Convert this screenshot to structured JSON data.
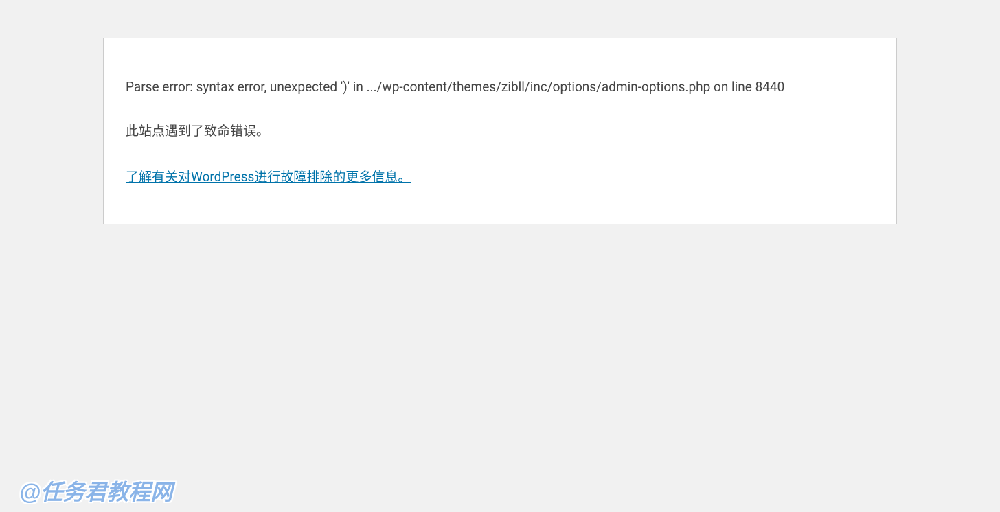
{
  "error": {
    "parse_error": "Parse error: syntax error, unexpected ')' in .../wp-content/themes/zibll/inc/options/admin-options.php on line 8440",
    "fatal_error": "此站点遇到了致命错误。",
    "help_link_text": "了解有关对WordPress进行故障排除的更多信息。"
  },
  "watermark": "@任务君教程网"
}
